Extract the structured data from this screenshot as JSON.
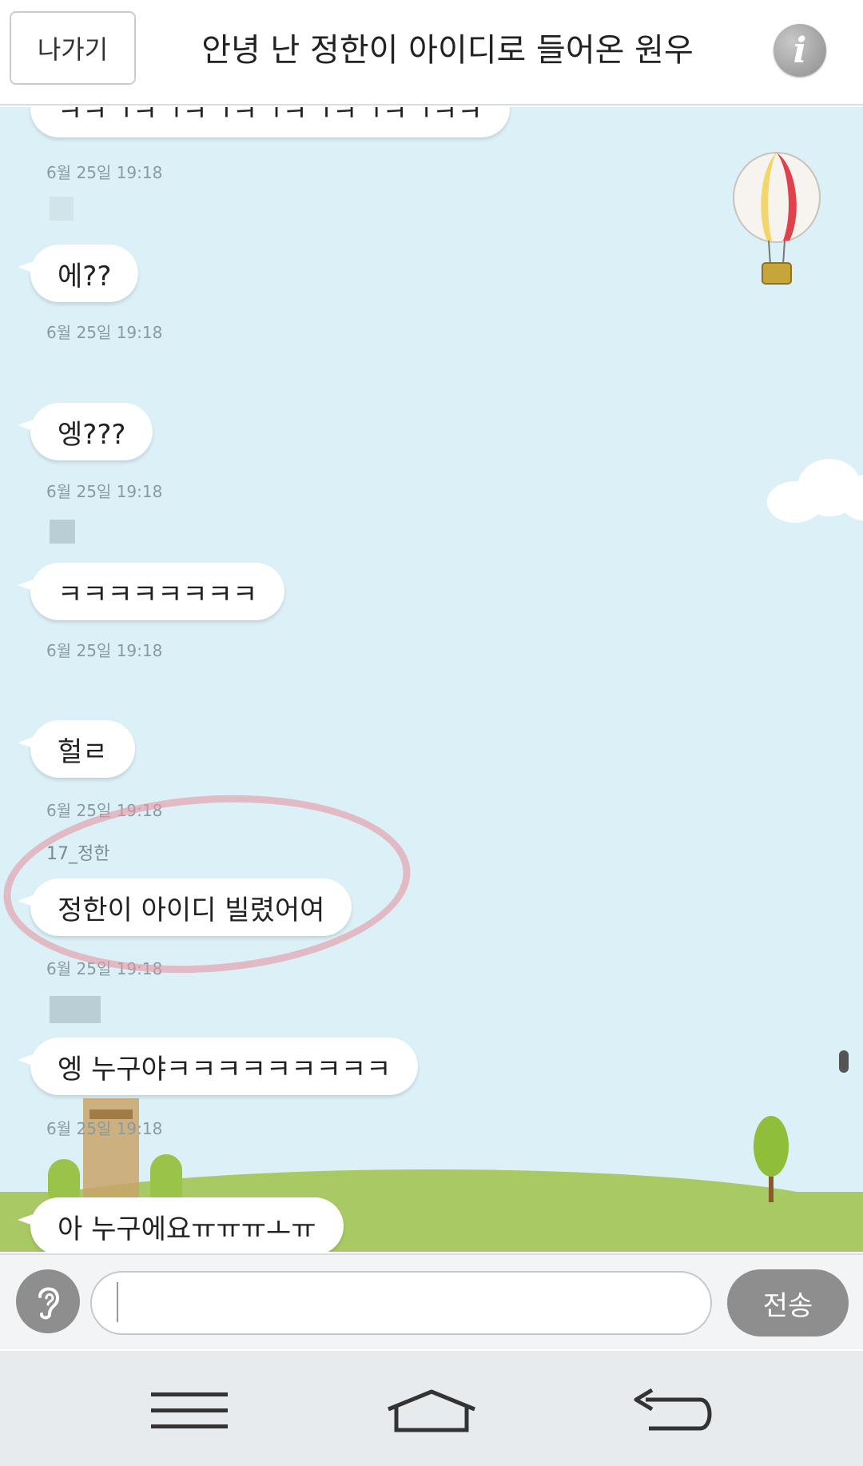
{
  "header": {
    "back_label": "나가기",
    "title": "안녕 난 정한이 아이디로 들어온 원우",
    "info_label": "i"
  },
  "messages": [
    {
      "text": "ㅋㅋㄱㅋㄱㅋㄱㅋㄱㅋㄱㅋㄱㅋㄱㅋㅋ",
      "time": "6월 25일 19:18"
    },
    {
      "text": "에??",
      "time": "6월 25일 19:18"
    },
    {
      "text": "엥???",
      "time": "6월 25일 19:18"
    },
    {
      "text": "ㅋㅋㅋㅋㅋㅋㅋㅋ",
      "time": "6월 25일 19:18"
    },
    {
      "text": "헐ㄹ",
      "time": "6월 25일 19:18"
    },
    {
      "sender": "17_정한",
      "text": "정한이 아이디 빌렸어여",
      "time": "6월 25일 19:18"
    },
    {
      "text": "엥 누구야ㅋㅋㅋㅋㅋㅋㅋㅋㅋ",
      "time": "6월 25일 19:18"
    },
    {
      "text": "아 누구에요ㅠㅠㅠㅗㅠ"
    }
  ],
  "input": {
    "voice_icon": "ear-icon",
    "value": "",
    "placeholder": "",
    "send_label": "전송"
  },
  "nav": {
    "menu_icon": "menu-icon",
    "home_icon": "home-icon",
    "back_icon": "back-arrow-icon"
  },
  "colors": {
    "chat_background": "#dcf0f7",
    "ground": "#a9c965",
    "button_gray": "#8e8e8e"
  }
}
